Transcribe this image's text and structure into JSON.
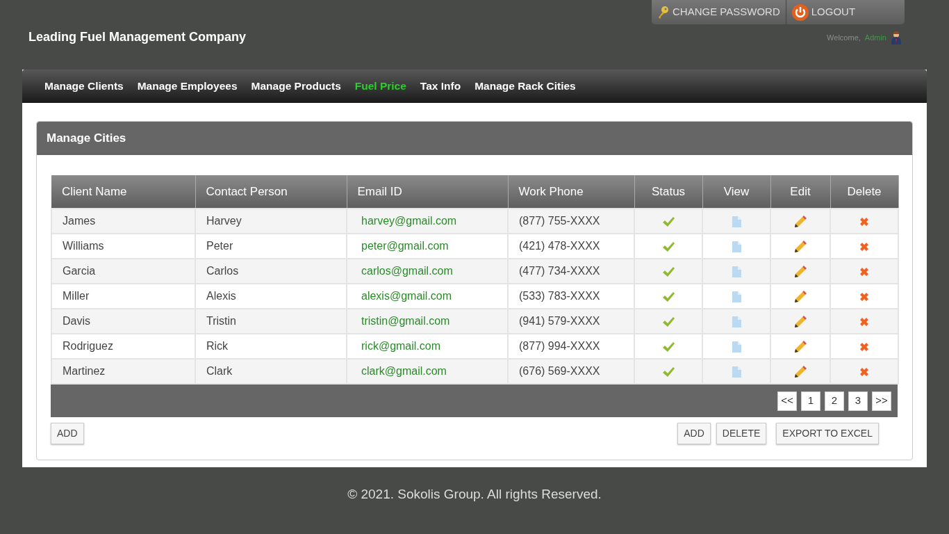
{
  "header": {
    "title": "Leading Fuel Management Company",
    "change_password": "CHANGE PASSWORD",
    "logout": "LOGOUT",
    "welcome": "Welcome,",
    "user": "Admin"
  },
  "nav": [
    {
      "label": "Manage Clients",
      "selected": false
    },
    {
      "label": "Manage Employees",
      "selected": false
    },
    {
      "label": "Manage Products",
      "selected": false
    },
    {
      "label": "Fuel Price",
      "selected": true
    },
    {
      "label": "Tax Info",
      "selected": false
    },
    {
      "label": "Manage Rack Cities",
      "selected": false
    }
  ],
  "panel": {
    "title": "Manage Cities"
  },
  "table": {
    "columns": [
      "Client Name",
      "Contact Person",
      "Email ID",
      "Work Phone",
      "Status",
      "View",
      "Edit",
      "Delete"
    ],
    "rows": [
      {
        "client": "James",
        "contact": "Harvey",
        "email": "harvey@gmail.com",
        "phone": "(877) 755-XXXX",
        "active": true
      },
      {
        "client": "Williams",
        "contact": "Peter",
        "email": "peter@gmail.com",
        "phone": "(421) 478-XXXX",
        "active": true
      },
      {
        "client": "Garcia",
        "contact": "Carlos",
        "email": "carlos@gmail.com",
        "phone": "(477) 734-XXXX",
        "active": true
      },
      {
        "client": "Miller",
        "contact": "Alexis",
        "email": "alexis@gmail.com",
        "phone": "(533) 783-XXXX",
        "active": true
      },
      {
        "client": "Davis",
        "contact": "Tristin",
        "email": "tristin@gmail.com",
        "phone": "(941) 579-XXXX",
        "active": true
      },
      {
        "client": "Rodriguez",
        "contact": "Rick",
        "email": "rick@gmail.com",
        "phone": "(877) 994-XXXX",
        "active": true
      },
      {
        "client": "Martinez",
        "contact": "Clark",
        "email": "clark@gmail.com",
        "phone": "(676) 569-XXXX",
        "active": true
      }
    ]
  },
  "pagination": [
    "<<",
    "1",
    "2",
    "3",
    ">>"
  ],
  "left_buttons": [
    "ADD"
  ],
  "right_buttons": [
    "ADD",
    "DELETE",
    "EXPORT TO EXCEL"
  ],
  "footer": "© 2021. Sokolis Group. All rights Reserved."
}
